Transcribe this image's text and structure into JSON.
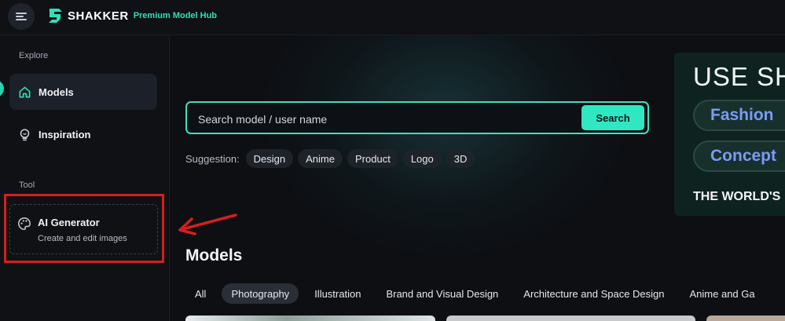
{
  "header": {
    "brand_name": "SHAKKER",
    "brand_subtitle": "Premium Model Hub",
    "brand_color": "#2fe0b6"
  },
  "sidebar": {
    "explore_label": "Explore",
    "items": [
      {
        "label": "Models",
        "icon": "home-icon",
        "active": true
      },
      {
        "label": "Inspiration",
        "icon": "lightbulb-icon",
        "active": false
      }
    ],
    "tool_label": "Tool",
    "tool": {
      "title": "AI Generator",
      "subtitle": "Create and edit images",
      "icon": "palette-icon"
    }
  },
  "search": {
    "placeholder": "Search model / user name",
    "button_label": "Search",
    "accent": "#3fe0bd"
  },
  "suggestions": {
    "label": "Suggestion:",
    "chips": [
      "Design",
      "Anime",
      "Product",
      "Logo",
      "3D"
    ]
  },
  "banner": {
    "title": "USE SH",
    "pills": [
      "Fashion",
      "Concept"
    ],
    "footer": "THE WORLD'S"
  },
  "models": {
    "heading": "Models",
    "tabs": [
      {
        "label": "All",
        "active": false
      },
      {
        "label": "Photography",
        "active": true
      },
      {
        "label": "Illustration",
        "active": false
      },
      {
        "label": "Brand and Visual Design",
        "active": false
      },
      {
        "label": "Architecture and Space Design",
        "active": false
      },
      {
        "label": "Anime and Ga",
        "active": false
      }
    ]
  },
  "annotation": {
    "highlight_color": "#d51f1f"
  }
}
